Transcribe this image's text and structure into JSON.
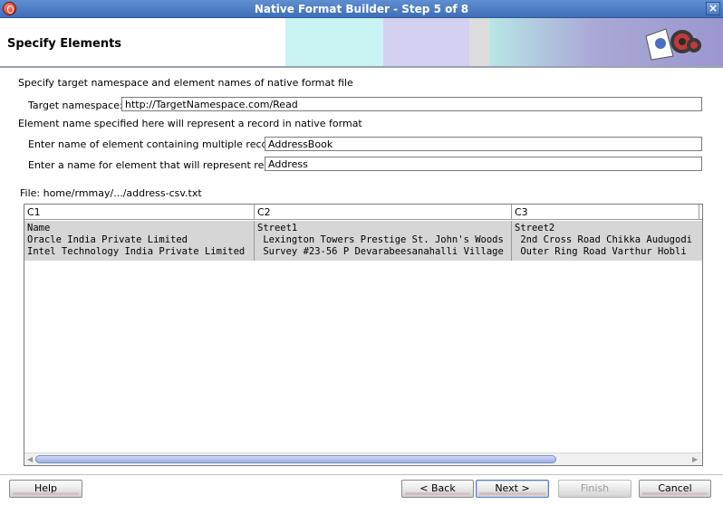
{
  "window": {
    "title": "Native Format Builder - Step 5 of 8",
    "close_glyph": "×"
  },
  "header": {
    "heading": "Specify Elements"
  },
  "form": {
    "instruction": "Specify target namespace and element names of native format file",
    "target_namespace_label": "Target namespace:",
    "target_namespace_value": "http://TargetNamespace.com/Read",
    "record_note": "Element name specified here will represent a record in native format",
    "multi_records_label": "Enter name of element containing multiple records:",
    "multi_records_value": "AddressBook",
    "record_element_label": "Enter a name for element that will represent record:",
    "record_element_value": "Address"
  },
  "file": {
    "label": "File: home/rmmay/.../address-csv.txt"
  },
  "table": {
    "columns": [
      "C1",
      "C2",
      "C3"
    ],
    "rows": [
      [
        "Name",
        "Street1",
        "Street2"
      ],
      [
        "Oracle India Private Limited",
        " Lexington Towers Prestige St. John's Woods",
        " 2nd Cross Road Chikka Audugodi"
      ],
      [
        "Intel Technology India Private Limited",
        " Survey #23-56 P Devarabeesanahalli Village",
        " Outer Ring Road Varthur Hobli"
      ]
    ],
    "row_background": "#d6d6d6"
  },
  "buttons": {
    "help": "Help",
    "back": "< Back",
    "next": "Next >",
    "finish": "Finish",
    "cancel": "Cancel"
  },
  "colors": {
    "titlebar": "#3e6fb8",
    "banner_cyan": "#c9f3f3",
    "banner_lavender": "#d4d0f2"
  }
}
